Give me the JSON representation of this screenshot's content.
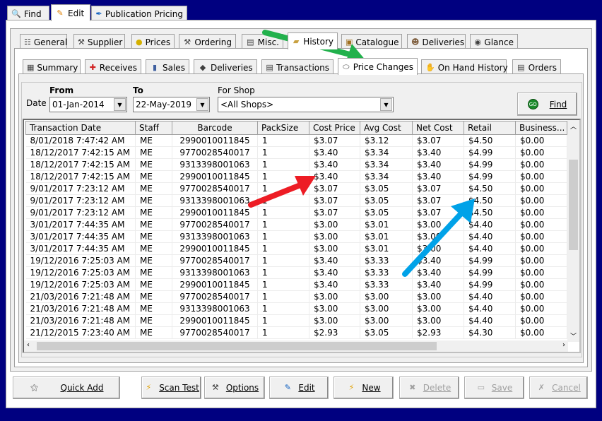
{
  "top_tabs": [
    {
      "label": "Find",
      "icon": "magnifier-icon"
    },
    {
      "label": "Edit",
      "icon": "pencil-icon",
      "active": true
    },
    {
      "label": "Publication Pricing",
      "icon": "blue-pen-icon"
    }
  ],
  "section_tabs": [
    {
      "label": "General",
      "icon": "list-icon"
    },
    {
      "label": "Supplier",
      "icon": "tools-icon"
    },
    {
      "label": "Prices",
      "icon": "coin-icon"
    },
    {
      "label": "Ordering",
      "icon": "hammer-icon"
    },
    {
      "label": "Misc.",
      "icon": "window-icon"
    },
    {
      "label": "History",
      "icon": "folder-icon",
      "active": true
    },
    {
      "label": "Catalogue",
      "icon": "book-icon"
    },
    {
      "label": "Deliveries",
      "icon": "people-icon"
    },
    {
      "label": "Glance",
      "icon": "binoculars-icon"
    }
  ],
  "history_tabs": [
    {
      "label": "Summary",
      "icon": "grid-icon"
    },
    {
      "label": "Receives",
      "icon": "plus-icon"
    },
    {
      "label": "Sales",
      "icon": "sales-icon"
    },
    {
      "label": "Deliveries",
      "icon": "box-icon"
    },
    {
      "label": "Transactions",
      "icon": "document-icon"
    },
    {
      "label": "Price Changes",
      "icon": "tag-icon",
      "active": true
    },
    {
      "label": "On Hand History",
      "icon": "hand-icon"
    },
    {
      "label": "Orders",
      "icon": "notepad-icon"
    }
  ],
  "filters": {
    "date_label": "Date",
    "from_label": "From",
    "from_value": "01-Jan-2014",
    "to_label": "To",
    "to_value": "22-May-2019",
    "shop_label": "For Shop",
    "shop_value": "<All Shops>",
    "find_label": "Find",
    "find_icon": "go-icon"
  },
  "table": {
    "columns": [
      "Transaction Date",
      "Staff",
      "Barcode",
      "PackSize",
      "Cost Price",
      "Avg Cost",
      "Net Cost",
      "Retail",
      "Business..."
    ],
    "rows": [
      [
        "8/01/2018 7:47:42 AM",
        "ME",
        "2990010011845",
        "1",
        "$3.07",
        "$3.12",
        "$3.07",
        "$4.50",
        "$0.00"
      ],
      [
        "18/12/2017 7:42:15 AM",
        "ME",
        "9770028540017",
        "1",
        "$3.40",
        "$3.34",
        "$3.40",
        "$4.99",
        "$0.00"
      ],
      [
        "18/12/2017 7:42:15 AM",
        "ME",
        "9313398001063",
        "1",
        "$3.40",
        "$3.34",
        "$3.40",
        "$4.99",
        "$0.00"
      ],
      [
        "18/12/2017 7:42:15 AM",
        "ME",
        "2990010011845",
        "1",
        "$3.40",
        "$3.34",
        "$3.40",
        "$4.99",
        "$0.00"
      ],
      [
        "9/01/2017 7:23:12 AM",
        "ME",
        "9770028540017",
        "1",
        "$3.07",
        "$3.05",
        "$3.07",
        "$4.50",
        "$0.00"
      ],
      [
        "9/01/2017 7:23:12 AM",
        "ME",
        "9313398001063",
        "1",
        "$3.07",
        "$3.05",
        "$3.07",
        "$4.50",
        "$0.00"
      ],
      [
        "9/01/2017 7:23:12 AM",
        "ME",
        "2990010011845",
        "1",
        "$3.07",
        "$3.05",
        "$3.07",
        "$4.50",
        "$0.00"
      ],
      [
        "3/01/2017 7:44:35 AM",
        "ME",
        "9770028540017",
        "1",
        "$3.00",
        "$3.01",
        "$3.00",
        "$4.40",
        "$0.00"
      ],
      [
        "3/01/2017 7:44:35 AM",
        "ME",
        "9313398001063",
        "1",
        "$3.00",
        "$3.01",
        "$3.00",
        "$4.40",
        "$0.00"
      ],
      [
        "3/01/2017 7:44:35 AM",
        "ME",
        "2990010011845",
        "1",
        "$3.00",
        "$3.01",
        "$3.00",
        "$4.40",
        "$0.00"
      ],
      [
        "19/12/2016 7:25:03 AM",
        "ME",
        "9770028540017",
        "1",
        "$3.40",
        "$3.33",
        "$3.40",
        "$4.99",
        "$0.00"
      ],
      [
        "19/12/2016 7:25:03 AM",
        "ME",
        "9313398001063",
        "1",
        "$3.40",
        "$3.33",
        "$3.40",
        "$4.99",
        "$0.00"
      ],
      [
        "19/12/2016 7:25:03 AM",
        "ME",
        "2990010011845",
        "1",
        "$3.40",
        "$3.33",
        "$3.40",
        "$4.99",
        "$0.00"
      ],
      [
        "21/03/2016 7:21:48 AM",
        "ME",
        "9770028540017",
        "1",
        "$3.00",
        "$3.00",
        "$3.00",
        "$4.40",
        "$0.00"
      ],
      [
        "21/03/2016 7:21:48 AM",
        "ME",
        "9313398001063",
        "1",
        "$3.00",
        "$3.00",
        "$3.00",
        "$4.40",
        "$0.00"
      ],
      [
        "21/03/2016 7:21:48 AM",
        "ME",
        "2990010011845",
        "1",
        "$3.00",
        "$3.00",
        "$3.00",
        "$4.40",
        "$0.00"
      ],
      [
        "21/12/2015 7:23:40 AM",
        "ME",
        "9770028540017",
        "1",
        "$2.93",
        "$3.05",
        "$2.93",
        "$4.30",
        "$0.00"
      ]
    ]
  },
  "buttons": [
    {
      "label": "Quick Add",
      "icon": "magic-wand-icon"
    },
    {
      "label": "Scan Test",
      "icon": "lightning-icon"
    },
    {
      "label": "Options",
      "icon": "tools-icon"
    },
    {
      "label": "Edit",
      "icon": "pencil-icon"
    },
    {
      "label": "New",
      "icon": "lightning-icon"
    },
    {
      "label": "Delete",
      "icon": "delete-icon",
      "disabled": true
    },
    {
      "label": "Save",
      "icon": "floppy-icon",
      "disabled": true
    },
    {
      "label": "Cancel",
      "icon": "cancel-icon",
      "disabled": true
    }
  ],
  "annotation_colors": {
    "green": "#22b14c",
    "red": "#ed1c24",
    "blue": "#00a2e8"
  }
}
